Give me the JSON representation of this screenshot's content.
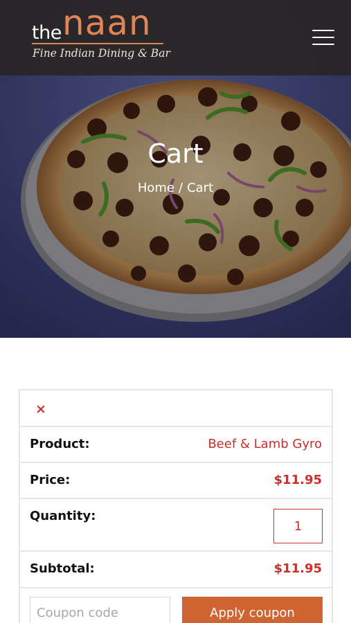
{
  "header": {
    "logo_the": "the",
    "logo_naan": "naan",
    "logo_tagline": "Fine Indian Dining & Bar",
    "menu_icon": "hamburger-menu-icon"
  },
  "hero": {
    "title": "Cart",
    "breadcrumb": {
      "home": "Home",
      "separator": "/",
      "current": "Cart"
    }
  },
  "cart": {
    "remove_icon": "close-icon",
    "remove_symbol": "×",
    "product_label": "Product:",
    "product_value": "Beef & Lamb Gyro",
    "price_label": "Price:",
    "price_value": "$11.95",
    "quantity_label": "Quantity:",
    "quantity_value": "1",
    "subtotal_label": "Subtotal:",
    "subtotal_value": "$11.95",
    "coupon_placeholder": "Coupon code",
    "apply_label": "Apply coupon"
  },
  "colors": {
    "accent": "#c9302c",
    "button": "#cf6532",
    "logo_orange": "#e08558",
    "header_bg": "#2a2624"
  }
}
